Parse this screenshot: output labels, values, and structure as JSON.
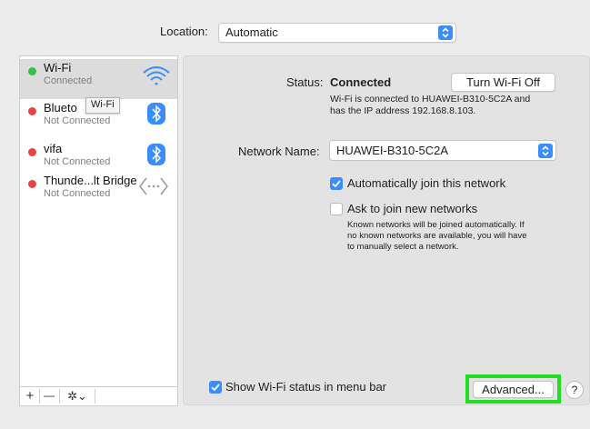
{
  "location": {
    "label": "Location:",
    "value": "Automatic"
  },
  "sidebar": {
    "services": [
      {
        "name": "Wi-Fi",
        "status": "Connected",
        "dot_color": "#34c04a",
        "icon": "wifi-icon",
        "selected": true
      },
      {
        "name": "Blueto",
        "status": "Not Connected",
        "dot_color": "#e84242",
        "icon": "bluetooth-icon",
        "selected": false
      },
      {
        "name": "vifa",
        "status": "Not Connected",
        "dot_color": "#e84242",
        "icon": "bluetooth-icon",
        "selected": false
      },
      {
        "name": "Thunde...lt Bridge",
        "status": "Not Connected",
        "dot_color": "#e84242",
        "icon": "thunderbolt-bridge-icon",
        "selected": false
      }
    ],
    "tooltip": "Wi-Fi",
    "toolbar": {
      "add": "+",
      "remove": "—",
      "actions": "✲⌄"
    }
  },
  "detail": {
    "status_label": "Status:",
    "status_value": "Connected",
    "turn_off_button": "Turn Wi-Fi Off",
    "status_desc_line1": "Wi-Fi is connected to HUAWEI-B310-5C2A and",
    "status_desc_line2": "has the IP address 192.168.8.103.",
    "network_name_label": "Network Name:",
    "network_name_value": "HUAWEI-B310-5C2A",
    "auto_join_label": "Automatically join this network",
    "auto_join_checked": true,
    "ask_join_label": "Ask to join new networks",
    "ask_join_checked": false,
    "ask_join_desc_line1": "Known networks will be joined automatically. If",
    "ask_join_desc_line2": "no known networks are available, you will have",
    "ask_join_desc_line3": "to manually select a network.",
    "show_status_label": "Show Wi-Fi status in menu bar",
    "show_status_checked": true,
    "advanced_button": "Advanced...",
    "help_button": "?",
    "highlight_color": "#22dd22",
    "accent_color": "#3a8dfd"
  }
}
